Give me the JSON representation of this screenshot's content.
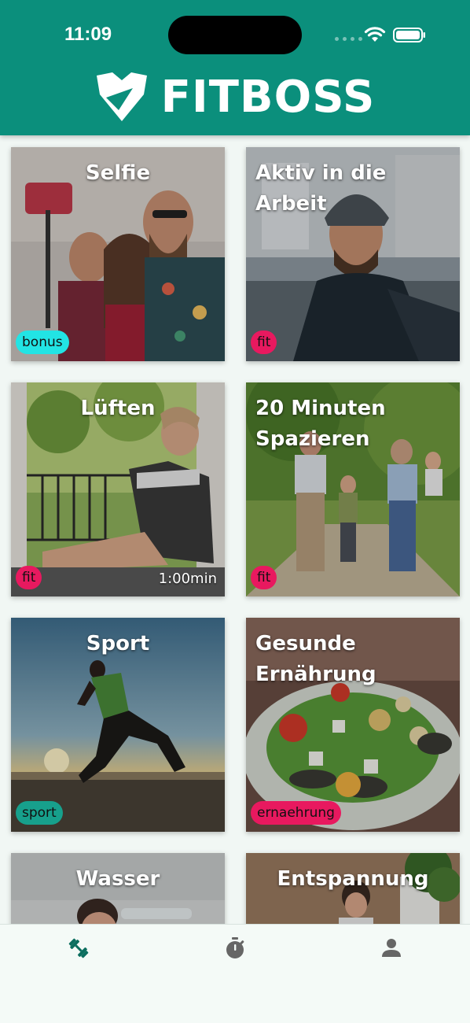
{
  "status_bar": {
    "time": "11:09"
  },
  "header": {
    "app_name": "FITBOSS"
  },
  "colors": {
    "header_bg": "#0b8f7c",
    "badge_bonus": "#22e4e4",
    "badge_fit": "#e8195f",
    "badge_sport": "#17a08c",
    "badge_ernaehrung": "#e8195f",
    "tab_active": "#0b6e5f",
    "tab_inactive": "#666666"
  },
  "tiles": [
    {
      "title": "Selfie",
      "badge": "bonus",
      "duration": "",
      "icon": "selfie-photo"
    },
    {
      "title": "Aktiv in die Arbeit",
      "badge": "fit",
      "duration": "",
      "icon": "cyclist-photo"
    },
    {
      "title": "Lüften",
      "badge": "fit",
      "duration": "1:00min",
      "icon": "window-photo"
    },
    {
      "title": "20 Minuten Spazieren",
      "badge": "fit",
      "duration": "",
      "icon": "walking-family-photo"
    },
    {
      "title": "Sport",
      "badge": "sport",
      "duration": "",
      "icon": "runner-photo"
    },
    {
      "title": "Gesunde Ernährung",
      "badge": "ernaehrung",
      "duration": "",
      "icon": "salad-photo"
    },
    {
      "title": "Wasser",
      "badge": "",
      "duration": "",
      "icon": "drinking-water-photo"
    },
    {
      "title": "Entspannung",
      "badge": "",
      "duration": "",
      "icon": "relaxation-photo"
    }
  ],
  "tabbar": {
    "items": [
      {
        "icon": "dumbbell-icon",
        "active": true
      },
      {
        "icon": "stopwatch-icon",
        "active": false
      },
      {
        "icon": "person-icon",
        "active": false
      }
    ]
  }
}
